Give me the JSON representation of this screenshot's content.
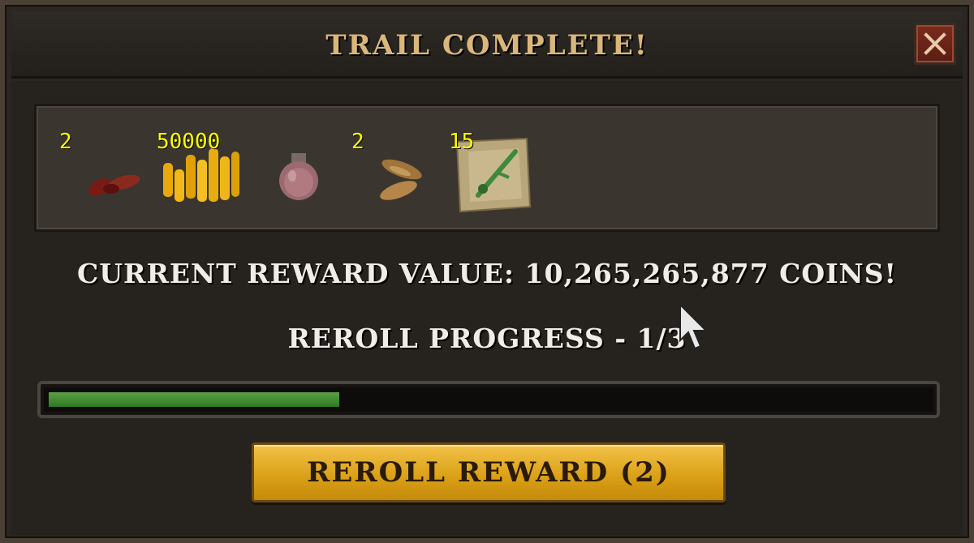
{
  "window": {
    "title": "TRAIL COMPLETE!",
    "close_icon": "close-icon"
  },
  "rewards": {
    "items": [
      {
        "quantity": "2",
        "icon": "red-feather-icon"
      },
      {
        "quantity": "50000",
        "icon": "coins-icon"
      },
      {
        "quantity": "",
        "icon": "potion-vial-icon"
      },
      {
        "quantity": "2",
        "icon": "brown-feather-icon"
      },
      {
        "quantity": "15",
        "icon": "map-scroll-icon"
      }
    ]
  },
  "summary": {
    "reward_value": "CURRENT REWARD VALUE: 10,265,265,877 COINS!",
    "reroll_progress": "REROLL PROGRESS - 1/3"
  },
  "progress": {
    "fraction": 0.33,
    "color": "#4a9a3a"
  },
  "actions": {
    "reroll_label": "REROLL REWARD (2)"
  },
  "colors": {
    "title": "#d9b77a",
    "button": "#e6a91c",
    "quantity": "#ffff00"
  }
}
